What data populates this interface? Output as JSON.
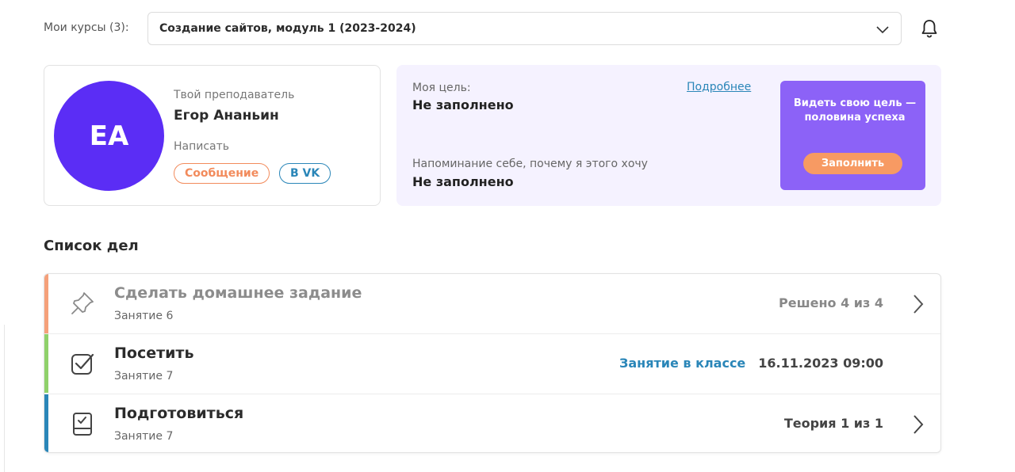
{
  "header": {
    "courses_label": "Мои курсы (3):",
    "selected_course": "Создание сайтов, модуль 1 (2023-2024)"
  },
  "teacher": {
    "initials": "ЕА",
    "role": "Твой преподаватель",
    "name": "Егор Ананьин",
    "write_label": "Написать",
    "message_button": "Сообщение",
    "vk_button": "В VK"
  },
  "goal": {
    "goal_label": "Моя цель:",
    "goal_value": "Не заполнено",
    "more_link": "Подробнее",
    "reminder_label": "Напоминание себе, почему я этого хочу",
    "reminder_value": "Не заполнено",
    "promo_text": "Видеть свою цель — половина успеха",
    "promo_button": "Заполнить"
  },
  "todo": {
    "title": "Список дел",
    "items": [
      {
        "title": "Сделать домашнее задание",
        "lesson": "Занятие 6",
        "status": "Решено 4 из 4",
        "icon": "pin-icon",
        "accent": "#f5a07a"
      },
      {
        "title": "Посетить",
        "lesson": "Занятие 7",
        "class_link": "Занятие в классе",
        "status": "16.11.2023 09:00",
        "icon": "checkbox-icon",
        "accent": "#8fd16a"
      },
      {
        "title": "Подготовиться",
        "lesson": "Занятие 7",
        "status": "Теория 1 из 1",
        "icon": "book-icon",
        "accent": "#2a86b8"
      }
    ]
  },
  "colors": {
    "avatar": "#5b2df5",
    "promo": "#8c62f7",
    "promo_button": "#f79a63",
    "link": "#2a86b8"
  }
}
